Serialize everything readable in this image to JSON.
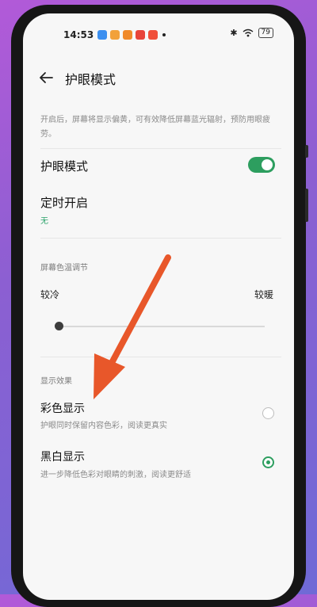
{
  "status_bar": {
    "time": "14:53",
    "battery": "79",
    "icons": [
      "bluetooth-icon",
      "wifi-icon",
      "battery-icon"
    ],
    "app_icons": [
      "app-blue-icon",
      "app-orange-icon",
      "app-orange-icon",
      "app-red-icon",
      "app-red-icon"
    ]
  },
  "header": {
    "title": "护眼模式",
    "back_icon": "back-arrow-icon"
  },
  "description": "开启后，屏幕将显示偏黄，可有效降低屏幕蓝光辐射，预防用眼疲劳。",
  "eye_mode": {
    "label": "护眼模式",
    "enabled": true
  },
  "schedule": {
    "label": "定时开启",
    "value": "无"
  },
  "color_temp": {
    "section_label": "屏幕色温调节",
    "left_label": "较冷",
    "right_label": "较暖",
    "level": 0
  },
  "display_effect": {
    "section_label": "显示效果",
    "options": [
      {
        "title": "彩色显示",
        "subtitle": "护眼同时保留内容色彩，阅读更真实",
        "selected": false
      },
      {
        "title": "黑白显示",
        "subtitle": "进一步降低色彩对眼睛的刺激，阅读更舒适",
        "selected": true
      }
    ]
  },
  "colors": {
    "accent": "#2d9e5f",
    "annotation_arrow": "#e8572a"
  }
}
